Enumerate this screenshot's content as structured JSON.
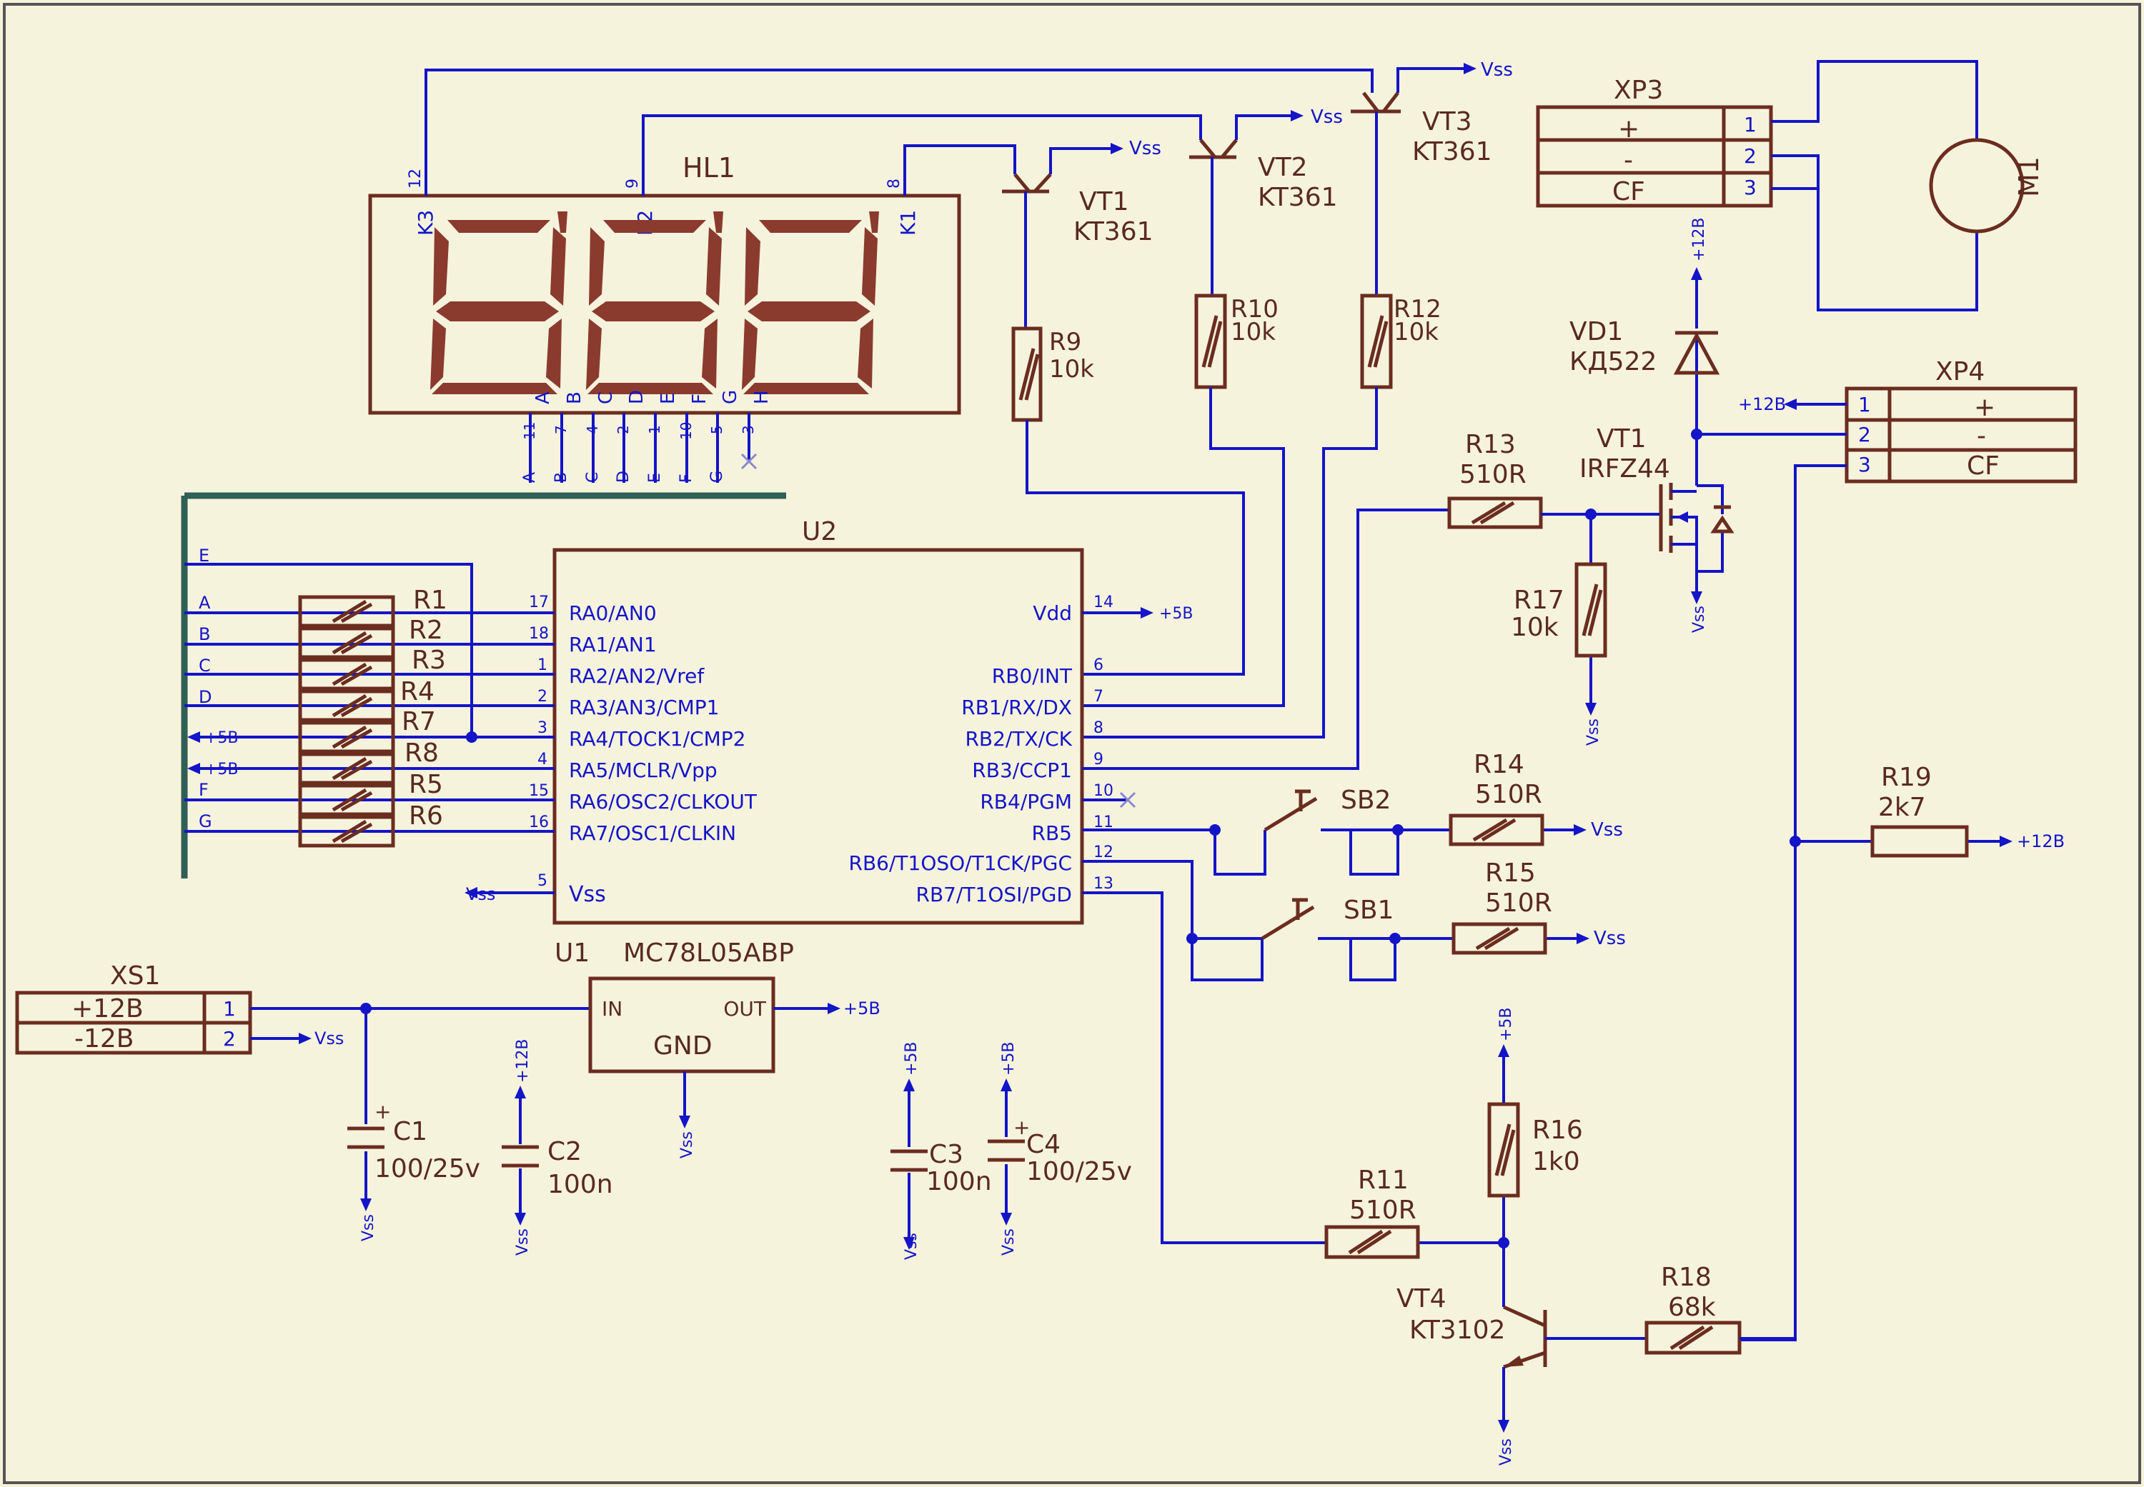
{
  "colors": {
    "background": "#f6f3dd",
    "wire": "#1414c8",
    "component": "#6b2d20",
    "segment": "#8a3b2e",
    "bus": "#2f5f55"
  },
  "display": {
    "name": "HL1",
    "k3": "K3",
    "k2": "K2",
    "k1": "K1",
    "seg_letters": [
      "A",
      "B",
      "C",
      "D",
      "E",
      "F",
      "G",
      "H"
    ],
    "seg_pins": [
      "11",
      "7",
      "4",
      "2",
      "1",
      "10",
      "5",
      "3"
    ],
    "bus_letters": [
      "A",
      "B",
      "C",
      "D",
      "E",
      "F",
      "G"
    ],
    "pin12": "12",
    "pin9": "9",
    "pin8": "8"
  },
  "transistors": {
    "vt1": {
      "name": "VT1",
      "type": "KT361"
    },
    "vt2": {
      "name": "VT2",
      "type": "KT361"
    },
    "vt3": {
      "name": "VT3",
      "type": "KT361"
    },
    "vt4": {
      "name": "VT4",
      "type": "KT3102"
    },
    "mosfet": {
      "name": "VT1",
      "type": "IRFZ44"
    }
  },
  "resistors": {
    "r9": {
      "name": "R9",
      "value": "10k"
    },
    "r10": {
      "name": "R10",
      "value": "10k"
    },
    "r12": {
      "name": "R12",
      "value": "10k"
    },
    "r13": {
      "name": "R13",
      "value": "510R"
    },
    "r17": {
      "name": "R17",
      "value": "10k"
    },
    "r14": {
      "name": "R14",
      "value": "510R"
    },
    "r15": {
      "name": "R15",
      "value": "510R"
    },
    "r19": {
      "name": "R19",
      "value": "2k7"
    },
    "r16": {
      "name": "R16",
      "value": "1k0"
    },
    "r11": {
      "name": "R11",
      "value": "510R"
    },
    "r18": {
      "name": "R18",
      "value": "68k"
    },
    "array": [
      "R1",
      "R2",
      "R3",
      "R4",
      "R7",
      "R8",
      "R5",
      "R6"
    ]
  },
  "mcu": {
    "name": "U2",
    "left_pins": [
      "RA0/AN0",
      "RA1/AN1",
      "RA2/AN2/Vref",
      "RA3/AN3/CMP1",
      "RA4/TOCK1/CMP2",
      "RA5/MCLR/Vpp",
      "RA6/OSC2/CLKOUT",
      "RA7/OSC1/CLKIN"
    ],
    "left_nums": [
      "17",
      "18",
      "1",
      "2",
      "3",
      "4",
      "15",
      "16"
    ],
    "left_nets": [
      "A",
      "B",
      "C",
      "D",
      "+5B",
      "+5B",
      "F",
      "G"
    ],
    "right_pins": [
      "RB0/INT",
      "RB1/RX/DX",
      "RB2/TX/CK",
      "RB3/CCP1",
      "RB4/PGM",
      "RB5",
      "RB6/T1OSO/T1CK/PGC",
      "RB7/T1OSI/PGD"
    ],
    "right_nums": [
      "6",
      "7",
      "8",
      "9",
      "10",
      "11",
      "12",
      "13"
    ],
    "vdd": "Vdd",
    "vdd_num": "14",
    "vss": "Vss",
    "vss_num": "5",
    "bus_e": "E"
  },
  "regulator": {
    "name": "U1",
    "type": "MC78L05ABP",
    "in": "IN",
    "out": "OUT",
    "gnd": "GND"
  },
  "connectors": {
    "xs1": {
      "name": "XS1",
      "rows": [
        "+12B",
        "-12B"
      ],
      "nums": [
        "1",
        "2"
      ]
    },
    "xp3": {
      "name": "XP3",
      "rows": [
        "+",
        "-",
        "CF"
      ],
      "nums": [
        "1",
        "2",
        "3"
      ]
    },
    "xp4": {
      "name": "XP4",
      "rows": [
        "+",
        "-",
        "CF"
      ],
      "nums": [
        "1",
        "2",
        "3"
      ]
    }
  },
  "caps": {
    "c1": {
      "name": "C1",
      "value": "100/25v"
    },
    "c2": {
      "name": "C2",
      "value": "100n"
    },
    "c3": {
      "name": "C3",
      "value": "100n"
    },
    "c4": {
      "name": "C4",
      "value": "100/25v"
    }
  },
  "diode": {
    "name": "VD1",
    "type": "КД522"
  },
  "motor": {
    "name": "M1"
  },
  "switches": {
    "sb1": "SB1",
    "sb2": "SB2"
  },
  "nets": {
    "vss": "Vss",
    "p5": "+5B",
    "p12": "+12B"
  }
}
